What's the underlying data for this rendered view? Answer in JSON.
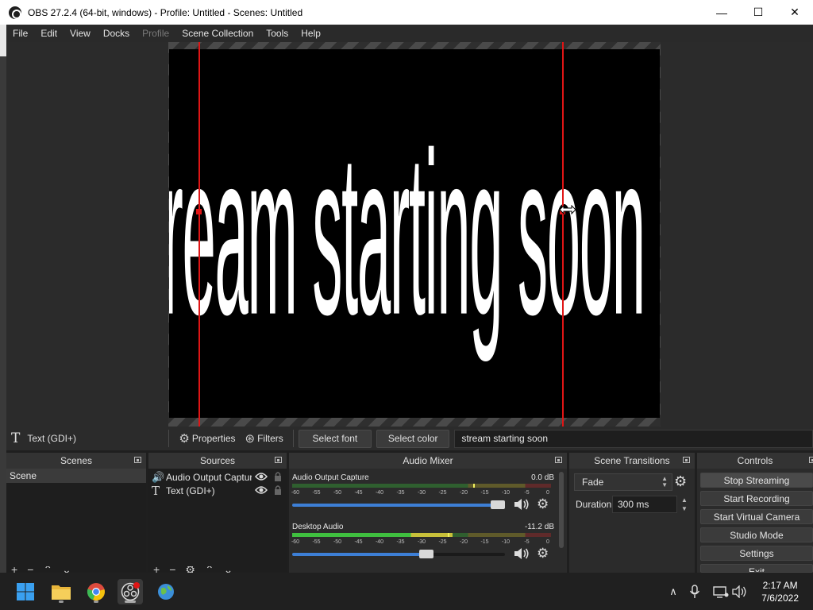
{
  "window": {
    "title": "OBS 27.2.4 (64-bit, windows) - Profile: Untitled - Scenes: Untitled",
    "minimize": "—",
    "maximize": "☐",
    "close": "✕"
  },
  "menu": [
    "File",
    "Edit",
    "View",
    "Docks",
    "Profile",
    "Scene Collection",
    "Tools",
    "Help"
  ],
  "canvas": {
    "text": "stream starting soon"
  },
  "source_toolbar": {
    "source_name": "Text (GDI+)",
    "properties": "Properties",
    "filters": "Filters",
    "select_font": "Select font",
    "select_color": "Select color",
    "text_value": "stream starting soon"
  },
  "docks": {
    "scenes": {
      "title": "Scenes",
      "items": [
        "Scene"
      ]
    },
    "sources": {
      "title": "Sources",
      "items": [
        {
          "name": "Audio Output Captur",
          "icon": "speaker-icon"
        },
        {
          "name": "Text (GDI+)",
          "icon": "text-icon"
        }
      ]
    },
    "mixer": {
      "title": "Audio Mixer",
      "channels": [
        {
          "name": "Audio Output Capture",
          "db": "0.0 dB",
          "level": 0.0,
          "peak": 0.7,
          "volume": 1.0
        },
        {
          "name": "Desktop Audio",
          "db": "-11.2 dB",
          "level": 0.62,
          "peak": 0.6,
          "volume": 0.64
        }
      ],
      "ticks": [
        "-60",
        "-55",
        "-50",
        "-45",
        "-40",
        "-35",
        "-30",
        "-25",
        "-20",
        "-15",
        "-10",
        "-5",
        "0"
      ]
    },
    "transitions": {
      "title": "Scene Transitions",
      "selected": "Fade",
      "duration_label": "Duration",
      "duration": "300 ms"
    },
    "controls": {
      "title": "Controls",
      "buttons": [
        "Stop Streaming",
        "Start Recording",
        "Start Virtual Camera",
        "Studio Mode",
        "Settings",
        "Exit"
      ]
    }
  },
  "taskbar": {
    "apps": [
      "windows-start",
      "file-explorer",
      "chrome",
      "obs-studio",
      "network-app"
    ],
    "time": "2:17 AM",
    "date": "7/6/2022"
  },
  "colors": {
    "selection": "#e01515",
    "volume_fill": "#3d7fd6",
    "dock_bg": "#2b2b2b"
  }
}
